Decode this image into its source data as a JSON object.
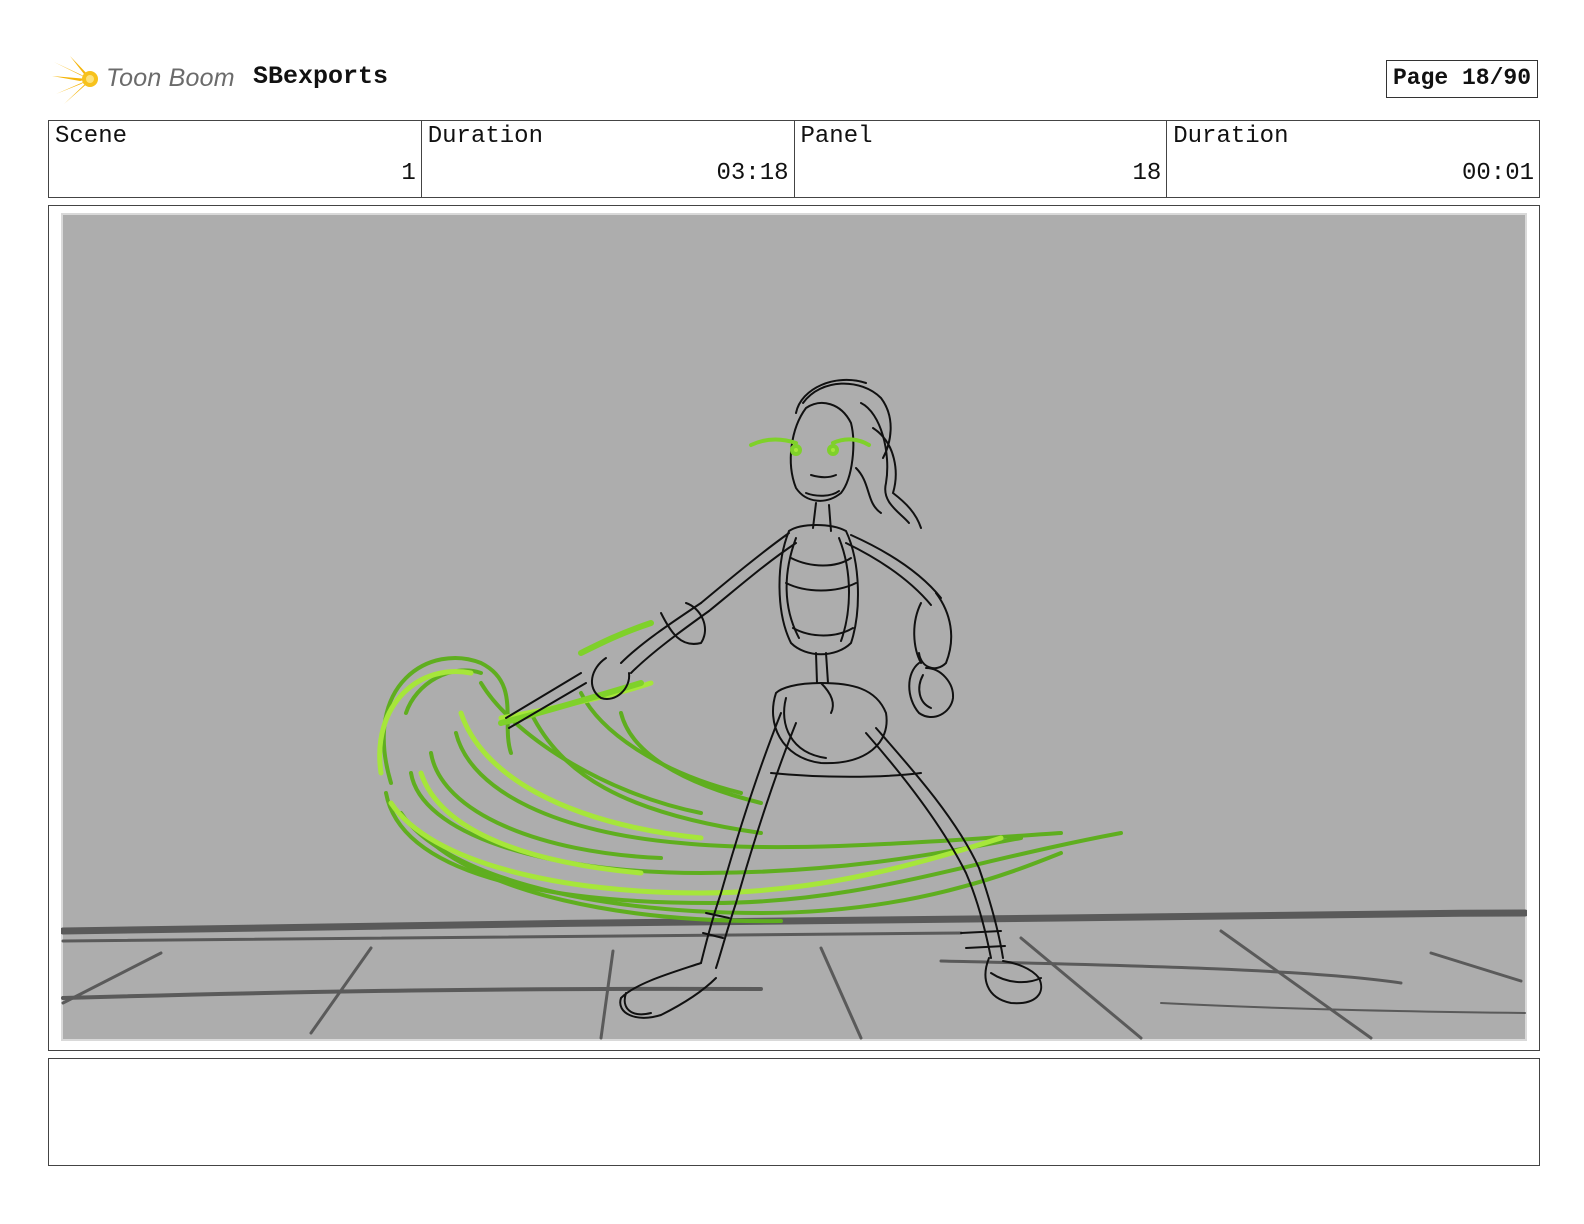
{
  "header": {
    "logo_text": "Toon Boom",
    "project_title": "SBexports",
    "page_label": "Page 18/90"
  },
  "info": [
    {
      "label": "Scene",
      "value": "1"
    },
    {
      "label": "Duration",
      "value": "03:18"
    },
    {
      "label": "Panel",
      "value": "18"
    },
    {
      "label": "Duration",
      "value": "00:01"
    }
  ],
  "panel": {
    "background_color": "#adadad",
    "sketch_color": "#111111",
    "floor_color": "#5a5a5a",
    "effect_colors": [
      "#7fd12a",
      "#5fae1f",
      "#a6e63a"
    ]
  },
  "notes": {
    "text": ""
  },
  "icons": {
    "logo": "toon-boom-logo-icon"
  }
}
